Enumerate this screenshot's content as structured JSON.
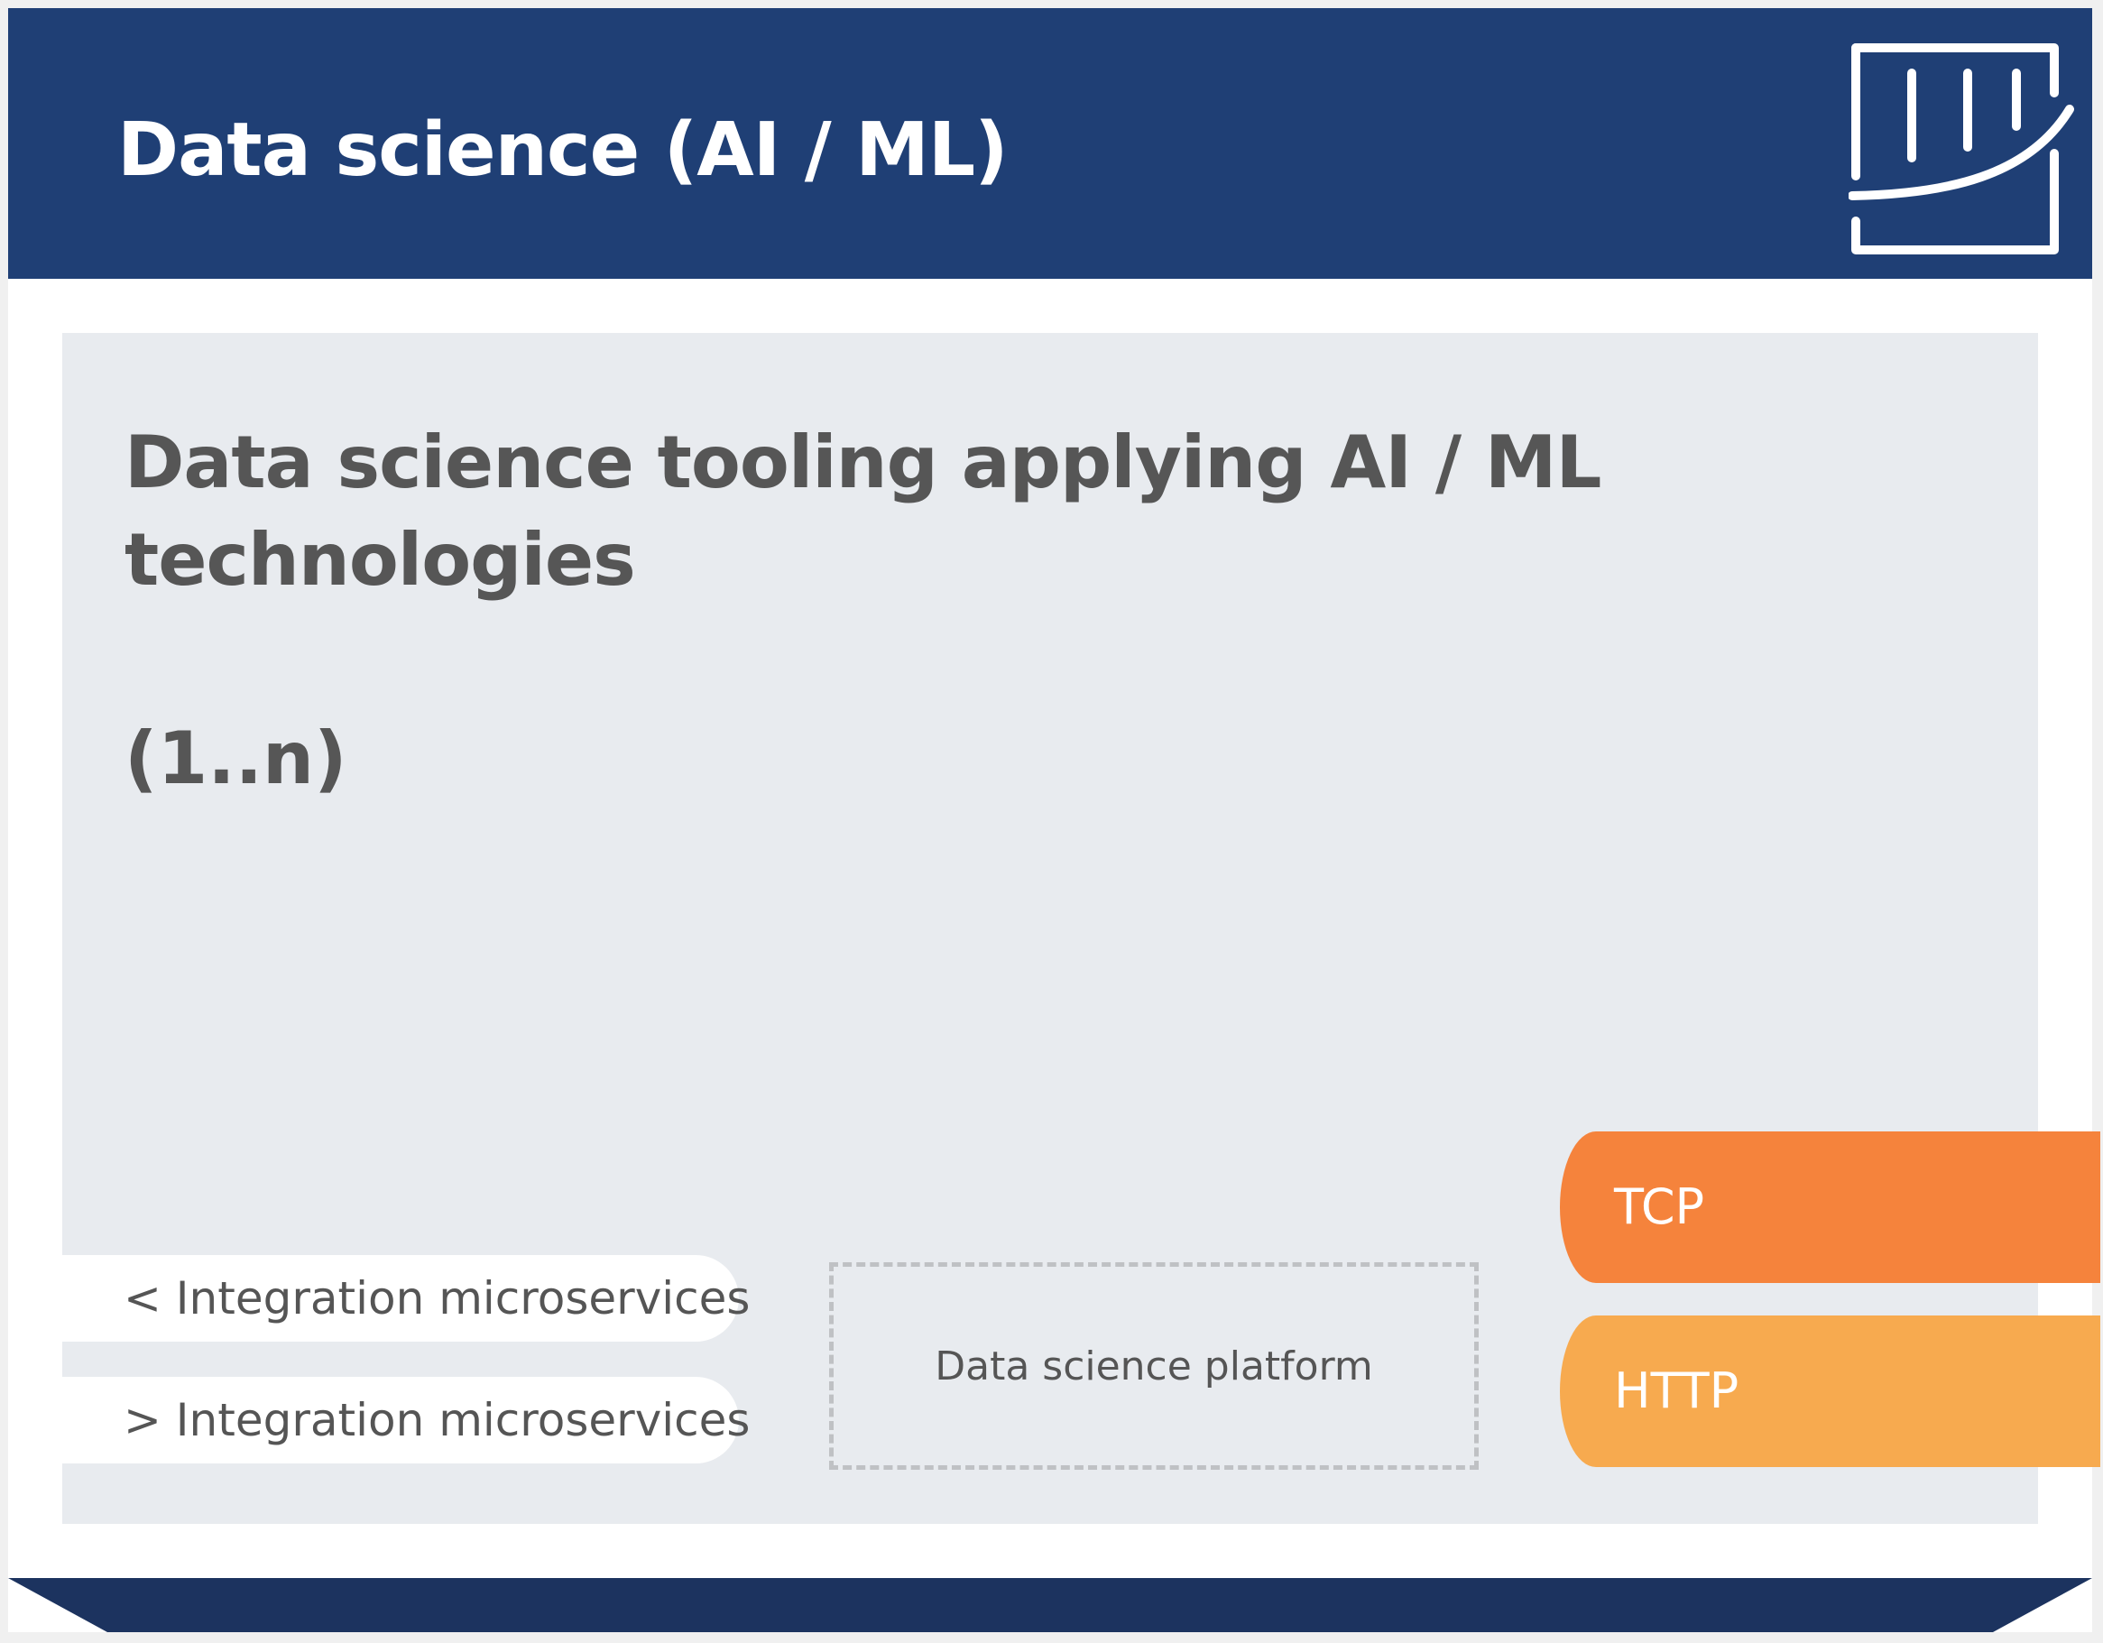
{
  "header": {
    "title": "Data science (AI / ML)",
    "logo_icon": "analytics-chart-icon",
    "background_color": "#1f3f75"
  },
  "panel": {
    "title": "Data science tooling applying AI / ML technologies",
    "multiplicity": "(1..n)",
    "background_color": "#e8ebef"
  },
  "integrations": [
    {
      "label": "< Integration microservices"
    },
    {
      "label": "> Integration microservices"
    }
  ],
  "platform": {
    "label": "Data science platform"
  },
  "protocols": [
    {
      "label": "TCP",
      "color": "#f5833c"
    },
    {
      "label": "HTTP",
      "color": "#f7aa4f"
    }
  ],
  "footer": {
    "color": "#1c335f"
  }
}
